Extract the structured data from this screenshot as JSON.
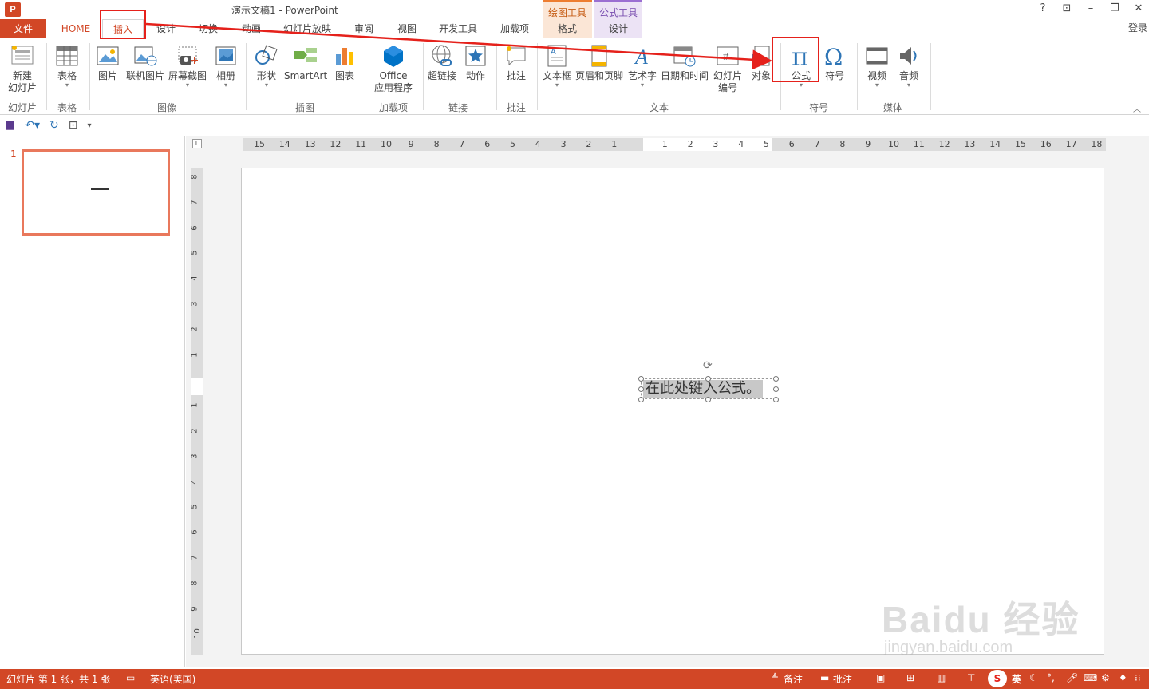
{
  "window": {
    "app_icon": "P",
    "title": "演示文稿1 - PowerPoint",
    "buttons": [
      "?",
      "⊡",
      "–",
      "❐",
      "✕"
    ]
  },
  "context_tools": {
    "drawing": {
      "title": "绘图工具",
      "tab": "格式"
    },
    "equation": {
      "title": "公式工具",
      "tab": "设计"
    }
  },
  "tabs": {
    "file": "文件",
    "home": "HOME",
    "insert": "插入",
    "design": "设计",
    "transitions": "切换",
    "animations": "动画",
    "slideshow": "幻灯片放映",
    "review": "审阅",
    "view": "视图",
    "developer": "开发工具",
    "addins": "加载项",
    "login": "登录"
  },
  "ribbon": {
    "new_slide": "新建",
    "new_slide2": "幻灯片",
    "table": "表格",
    "picture": "图片",
    "online_picture": "联机图片",
    "screenshot": "屏幕截图",
    "album": "相册",
    "shapes": "形状",
    "smartart": "SmartArt",
    "chart": "图表",
    "office_apps1": "Office",
    "office_apps2": "应用程序",
    "hyperlink": "超链接",
    "action": "动作",
    "comment": "批注",
    "textbox": "文本框",
    "header_footer": "页眉和页脚",
    "wordart": "艺术字",
    "datetime": "日期和时间",
    "slide_number1": "幻灯片",
    "slide_number2": "编号",
    "object": "对象",
    "equation": "公式",
    "symbol": "符号",
    "video": "视频",
    "audio": "音频",
    "groups": {
      "slides": "幻灯片",
      "tables": "表格",
      "images": "图像",
      "illustrations": "插图",
      "addins": "加载项",
      "links": "链接",
      "comments": "批注",
      "text": "文本",
      "symbols": "符号",
      "media": "媒体"
    }
  },
  "slides_pane": {
    "slide_number": "1"
  },
  "ruler": {
    "corner": "L",
    "h_ticks": [
      "15",
      "14",
      "13",
      "12",
      "11",
      "10",
      "9",
      "8",
      "7",
      "6",
      "5",
      "4",
      "3",
      "2",
      "1",
      "1",
      "2",
      "3",
      "4",
      "5",
      "6",
      "7",
      "8",
      "9",
      "10",
      "11",
      "12",
      "13",
      "14",
      "15",
      "16",
      "17",
      "18"
    ],
    "v_ticks": [
      "8",
      "7",
      "6",
      "5",
      "4",
      "3",
      "2",
      "1",
      "1",
      "2",
      "3",
      "4",
      "5",
      "6",
      "7",
      "8",
      "9",
      "10"
    ]
  },
  "slide": {
    "equation_placeholder": "在此处键入公式。"
  },
  "statusbar": {
    "slide_info": "幻灯片 第 1 张，共 1 张",
    "language": "英语(美国)",
    "notes": "备注",
    "comments": "批注",
    "ime": "英"
  },
  "watermark": {
    "logo": "Baidu 经验",
    "url": "jingyan.baidu.com"
  },
  "colors": {
    "accent": "#d24726",
    "annotation": "#e5211b"
  }
}
